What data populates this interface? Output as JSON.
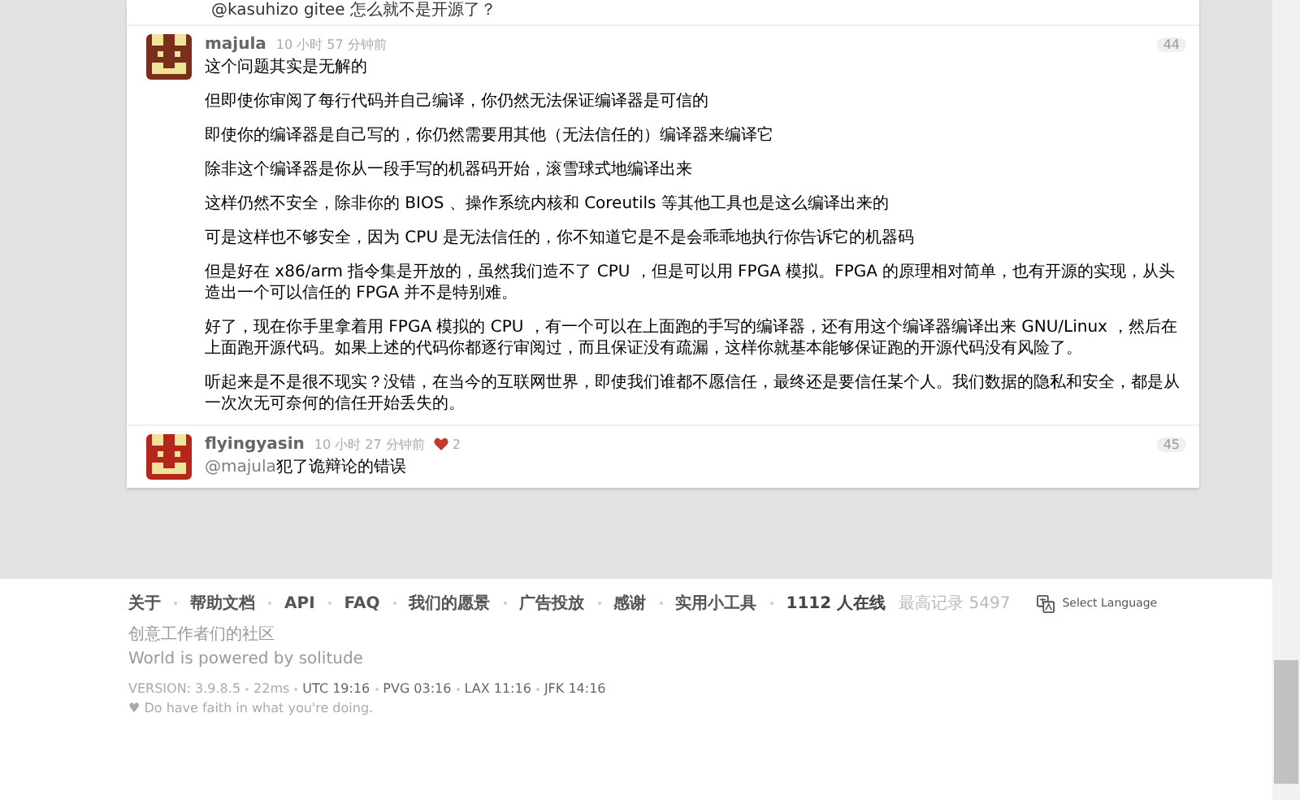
{
  "previous_reply_text": "@kasuhizo gitee 怎么就不是开源了？",
  "replies": [
    {
      "author": "majula",
      "time": "10 小时 57 分钟前",
      "number": "44",
      "color": "#7a2e1c",
      "paragraphs": [
        "这个问题其实是无解的",
        "但即使你审阅了每行代码并自己编译，你仍然无法保证编译器是可信的",
        "即使你的编译器是自己写的，你仍然需要用其他（无法信任的）编译器来编译它",
        "除非这个编译器是你从一段手写的机器码开始，滚雪球式地编译出来",
        "这样仍然不安全，除非你的 BIOS 、操作系统内核和 Coreutils 等其他工具也是这么编译出来的",
        "可是这样也不够安全，因为 CPU 是无法信任的，你不知道它是不是会乖乖地执行你告诉它的机器码",
        "但是好在 x86/arm 指令集是开放的，虽然我们造不了 CPU ，但是可以用 FPGA 模拟。FPGA 的原理相对简单，也有开源的实现，从头造出一个可以信任的 FPGA 并不是特别难。",
        "好了，现在你手里拿着用 FPGA 模拟的 CPU ，有一个可以在上面跑的手写的编译器，还有用这个编译器编译出来 GNU/Linux ，然后在上面跑开源代码。如果上述的代码你都逐行审阅过，而且保证没有疏漏，这样你就基本能够保证跑的开源代码没有风险了。",
        "听起来是不是很不现实？没错，在当今的互联网世界，即使我们谁都不愿信任，最终还是要信任某个人。我们数据的隐私和安全，都是从一次次无可奈何的信任开始丢失的。"
      ]
    },
    {
      "author": "flyingyasin",
      "time": "10 小时 27 分钟前",
      "number": "45",
      "color": "#b5261c",
      "likes": "2",
      "mention": "@majula",
      "paragraphs": [
        "犯了诡辩论的错误"
      ]
    }
  ],
  "footer": {
    "links": [
      {
        "label": "关于",
        "kind": "link"
      },
      {
        "label": "帮助文档",
        "kind": "link"
      },
      {
        "label": "API",
        "kind": "link"
      },
      {
        "label": "FAQ",
        "kind": "link"
      },
      {
        "label": "我们的愿景",
        "kind": "link"
      },
      {
        "label": "广告投放",
        "kind": "link"
      },
      {
        "label": "感谢",
        "kind": "link"
      },
      {
        "label": "实用小工具",
        "kind": "link"
      },
      {
        "label": "1112 人在线",
        "kind": "stat"
      }
    ],
    "record": "最高记录 5497",
    "language": "Select Language",
    "tagline": "创意工作者们的社区",
    "motto": "World is powered by solitude",
    "version": [
      {
        "text": "VERSION: 3.9.8.5",
        "muted": true
      },
      {
        "text": "22ms",
        "muted": true
      },
      {
        "text": "UTC 19:16",
        "muted": false
      },
      {
        "text": "PVG 03:16",
        "muted": false
      },
      {
        "text": "LAX 11:16",
        "muted": false
      },
      {
        "text": "JFK 14:16",
        "muted": false
      }
    ],
    "faith": "♥ Do have faith in what you're doing."
  }
}
